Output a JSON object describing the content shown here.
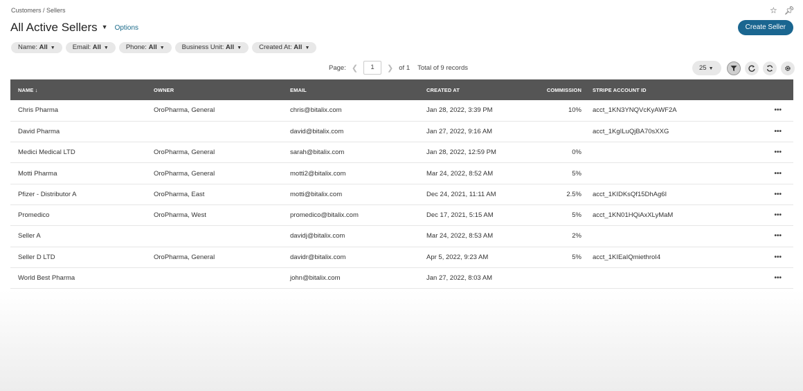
{
  "breadcrumb": "Customers / Sellers",
  "page": {
    "title": "All Active Sellers",
    "options_label": "Options",
    "create_button": "Create Seller"
  },
  "filters": [
    {
      "label": "Name:",
      "value": "All"
    },
    {
      "label": "Email:",
      "value": "All"
    },
    {
      "label": "Phone:",
      "value": "All"
    },
    {
      "label": "Business Unit:",
      "value": "All"
    },
    {
      "label": "Created At:",
      "value": "All"
    }
  ],
  "pager": {
    "page_label": "Page:",
    "current_page": "1",
    "of_label": "of 1",
    "total_label": "Total of 9 records",
    "per_page": "25"
  },
  "table": {
    "headers": {
      "name": "NAME",
      "owner": "OWNER",
      "email": "EMAIL",
      "created_at": "CREATED AT",
      "commission": "COMMISSION",
      "stripe": "STRIPE ACCOUNT ID"
    },
    "sort_indicator": "↓",
    "rows": [
      {
        "name": "Chris Pharma",
        "owner": "OroPharma, General",
        "email": "chris@bitalix.com",
        "created_at": "Jan 28, 2022, 3:39 PM",
        "commission": "10%",
        "stripe": "acct_1KN3YNQVcKyAWF2A",
        "actions": "•••"
      },
      {
        "name": "David Pharma",
        "owner": "",
        "email": "david@bitalix.com",
        "created_at": "Jan 27, 2022, 9:16 AM",
        "commission": "",
        "stripe": "acct_1KgILuQjBA70sXXG",
        "actions": "•••"
      },
      {
        "name": "Medici Medical LTD",
        "owner": "OroPharma, General",
        "email": "sarah@bitalix.com",
        "created_at": "Jan 28, 2022, 12:59 PM",
        "commission": "0%",
        "stripe": "",
        "actions": "•••"
      },
      {
        "name": "Motti Pharma",
        "owner": "OroPharma, General",
        "email": "motti2@bitalix.com",
        "created_at": "Mar 24, 2022, 8:52 AM",
        "commission": "5%",
        "stripe": "",
        "actions": "•••"
      },
      {
        "name": "Pfizer - Distributor A",
        "owner": "OroPharma, East",
        "email": "motti@bitalix.com",
        "created_at": "Dec 24, 2021, 11:11 AM",
        "commission": "2.5%",
        "stripe": "acct_1KIDKsQf15DhAg6I",
        "actions": "•••"
      },
      {
        "name": "Promedico",
        "owner": "OroPharma, West",
        "email": "promedico@bitalix.com",
        "created_at": "Dec 17, 2021, 5:15 AM",
        "commission": "5%",
        "stripe": "acct_1KN01HQiAxXLyMaM",
        "actions": "•••"
      },
      {
        "name": "Seller A",
        "owner": "",
        "email": "davidj@bitalix.com",
        "created_at": "Mar 24, 2022, 8:53 AM",
        "commission": "2%",
        "stripe": "",
        "actions": "•••"
      },
      {
        "name": "Seller D LTD",
        "owner": "OroPharma, General",
        "email": "davidr@bitalix.com",
        "created_at": "Apr 5, 2022, 9:23 AM",
        "commission": "5%",
        "stripe": "acct_1KIEaIQmiethroI4",
        "actions": "•••"
      },
      {
        "name": "World Best Pharma",
        "owner": "",
        "email": "john@bitalix.com",
        "created_at": "Jan 27, 2022, 8:03 AM",
        "commission": "",
        "stripe": "",
        "actions": "•••"
      }
    ]
  },
  "icons": {
    "star": "star-icon",
    "pin": "pin-icon",
    "filter": "filter-icon",
    "reload": "reload-icon",
    "refresh": "refresh-icon",
    "settings": "gear-icon"
  },
  "colors": {
    "accent": "#1a6690",
    "header_bg": "#555555",
    "link": "#1a6a8a"
  }
}
